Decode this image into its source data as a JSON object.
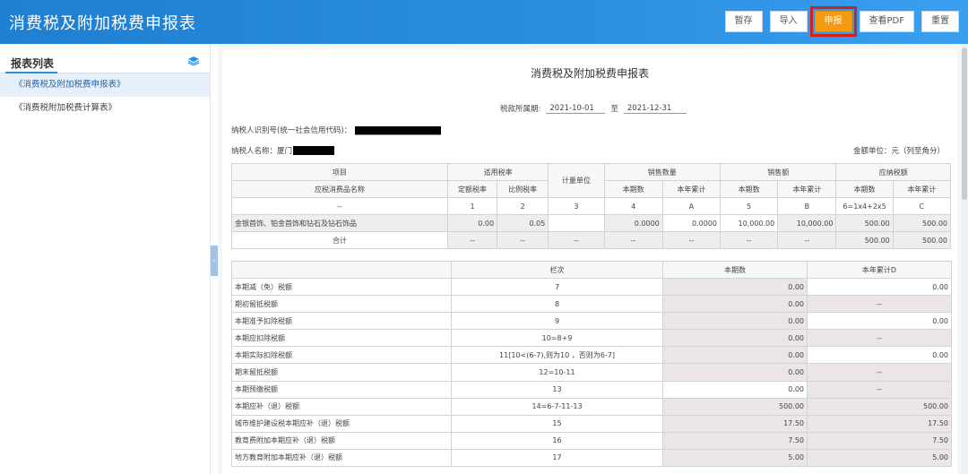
{
  "app": {
    "title": "消费税及附加税费申报表"
  },
  "toolbar": {
    "save": "暂存",
    "import": "导入",
    "declare": "申报",
    "view_pdf": "查看PDF",
    "reset": "重置"
  },
  "sidebar": {
    "title": "报表列表",
    "items": [
      {
        "label": "《消费税及附加税费申报表》"
      },
      {
        "label": "《消费税附加税费计算表》"
      }
    ]
  },
  "doc": {
    "title": "消费税及附加税费申报表",
    "period_label": "税款所属期:",
    "period_from": "2021-10-01",
    "period_to_label": "至",
    "period_to": "2021-12-31",
    "taxid_label": "纳税人识别号(统一社会信用代码)：",
    "taxname_label": "纳税人名称：",
    "taxname_value": "厦门",
    "unit_label": "金额单位：元（列至角分）"
  },
  "table1": {
    "h_item": "项目",
    "h_rate": "适用税率",
    "h_unit": "计量单位",
    "h_qty": "销售数量",
    "h_amt": "销售额",
    "h_tax": "应纳税额",
    "h_name": "应税消费品名称",
    "h_fixed": "定额税率",
    "h_ratio": "比例税率",
    "h_cur": "本期数",
    "h_ytd": "本年累计",
    "code": {
      "name": "--",
      "fixed": "1",
      "ratio": "2",
      "unit": "3",
      "qty_cur": "4",
      "qty_ytd": "A",
      "amt_cur": "5",
      "amt_ytd": "B",
      "tax_cur": "6=1x4+2x5",
      "tax_ytd": "C"
    },
    "row": {
      "name": "金银首饰、铂金首饰和钻石及钻石饰品",
      "fixed": "0.00",
      "ratio": "0.05",
      "unit": "",
      "qty_cur": "0.0000",
      "qty_ytd": "0.0000",
      "amt_cur": "10,000.00",
      "amt_ytd": "10,000.00",
      "tax_cur": "500.00",
      "tax_ytd": "500.00"
    },
    "total": {
      "name": "合计",
      "fixed": "--",
      "ratio": "--",
      "unit": "--",
      "qty_cur": "--",
      "qty_ytd": "--",
      "amt_cur": "--",
      "amt_ytd": "--",
      "tax_cur": "500.00",
      "tax_ytd": "500.00"
    }
  },
  "table2": {
    "h_blank": "",
    "h_col": "栏次",
    "h_cur": "本期数",
    "h_ytd": "本年累计D",
    "rows": [
      {
        "name": "本期减（免）税额",
        "rule": "7",
        "cur": "0.00",
        "ytd": "0.00"
      },
      {
        "name": "期初留抵税额",
        "rule": "8",
        "cur": "0.00",
        "ytd": "--"
      },
      {
        "name": "本期准予扣除税额",
        "rule": "9",
        "cur": "0.00",
        "ytd": "0.00"
      },
      {
        "name": "本期应扣除税额",
        "rule": "10=8+9",
        "cur": "0.00",
        "ytd": "--"
      },
      {
        "name": "本期实际扣除税额",
        "rule": "11[10<(6-7),则为10 ，否则为6-7]",
        "cur": "0.00",
        "ytd": "0.00"
      },
      {
        "name": "期末留抵税额",
        "rule": "12=10-11",
        "cur": "0.00",
        "ytd": "--"
      },
      {
        "name": "本期预缴税额",
        "rule": "13",
        "cur": "0.00",
        "ytd": "--"
      },
      {
        "name": "本期应补（退）税额",
        "rule": "14=6-7-11-13",
        "cur": "500.00",
        "ytd": "500.00"
      },
      {
        "name": "城市维护建设税本期应补（退）税额",
        "rule": "15",
        "cur": "17.50",
        "ytd": "17.50"
      },
      {
        "name": "教育费附加本期应补（退）税额",
        "rule": "16",
        "cur": "7.50",
        "ytd": "7.50"
      },
      {
        "name": "地方教育附加本期应补（退）税额",
        "rule": "17",
        "cur": "5.00",
        "ytd": "5.00"
      }
    ]
  },
  "colors": {
    "header": "#2b8ee0",
    "declare_button": "#f39c12",
    "highlight_box": "#d22020"
  }
}
